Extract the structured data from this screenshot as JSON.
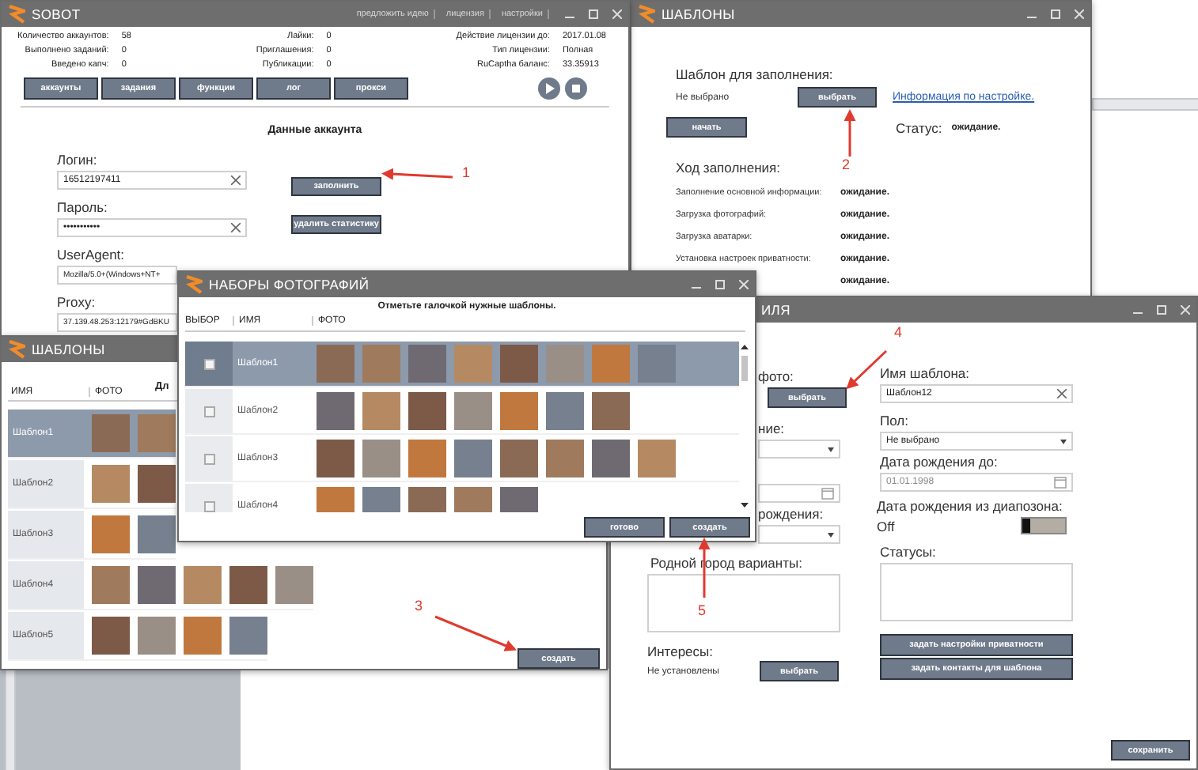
{
  "main_window": {
    "title": "SOBOT",
    "menu": [
      "предложить идею",
      "лицензия",
      "настройки"
    ],
    "stats": [
      [
        {
          "label": "Количество аккаунтов:",
          "value": "58"
        },
        {
          "label": "Выполнено заданий:",
          "value": "0"
        },
        {
          "label": "Введено капч:",
          "value": "0"
        }
      ],
      [
        {
          "label": "Лайки:",
          "value": "0"
        },
        {
          "label": "Приглашения:",
          "value": "0"
        },
        {
          "label": "Публикации:",
          "value": "0"
        }
      ],
      [
        {
          "label": "Действие лицензии до:",
          "value": "2017.01.08"
        },
        {
          "label": "Тип лицензии:",
          "value": "Полная"
        },
        {
          "label": "RuCaptha баланс:",
          "value": "33.35913"
        }
      ]
    ],
    "nav": [
      "аккаунты",
      "задания",
      "функции",
      "лог",
      "прокси"
    ],
    "section_title": "Данные аккаунта",
    "fields": [
      {
        "label": "Логин:",
        "value": "16512197411",
        "clearable": true
      },
      {
        "label": "Пароль:",
        "value": "•••••••••••",
        "clearable": true
      },
      {
        "label": "UserAgent:",
        "value": "Mozilla/5.0+(Windows+NT+",
        "clearable": false
      },
      {
        "label": "Proxy:",
        "value": "37.139.48.253:12179#GdBKU",
        "clearable": false
      }
    ],
    "buttons": [
      "заполнить",
      "удалить статистику"
    ]
  },
  "fill_window": {
    "title": "ШАБЛОНЫ",
    "template_label": "Шаблон для заполнения:",
    "template_value": "Не выбрано",
    "choose_button": "выбрать",
    "help_link": "Информация по настройке.",
    "start_button": "начать",
    "status_label": "Статус:",
    "status_value": "ожидание.",
    "progress_title": "Ход заполнения:",
    "progress": [
      {
        "label": "Заполнение основной информации:",
        "status": "ожидание."
      },
      {
        "label": "Загрузка фотографий:",
        "status": "ожидание."
      },
      {
        "label": "Загрузка аватарки:",
        "status": "ожидание."
      },
      {
        "label": "Установка настроек приватности:",
        "status": "ожидание."
      },
      {
        "status": "ожидание."
      }
    ]
  },
  "templates_window": {
    "title": "ШАБЛОНЫ",
    "heading": "Дл",
    "columns": [
      "ИМЯ",
      "ФОТО"
    ],
    "rows": [
      {
        "name": "Шаблон1",
        "selected": true
      },
      {
        "name": "Шаблон2",
        "selected": false
      },
      {
        "name": "Шаблон3",
        "selected": false
      },
      {
        "name": "Шаблон4",
        "selected": false
      },
      {
        "name": "Шаблон5",
        "selected": false
      }
    ],
    "create_button": "создать"
  },
  "photo_sets_window": {
    "title": "НАБОРЫ ФОТОГРАФИЙ",
    "hint": "Отметьте галочкой нужные шаблоны.",
    "columns": [
      "ВЫБОР",
      "ИМЯ",
      "ФОТО"
    ],
    "rows": [
      {
        "name": "Шаблон1",
        "selected": true,
        "checked": false
      },
      {
        "name": "Шаблон2",
        "selected": false,
        "checked": false
      },
      {
        "name": "Шаблон3",
        "selected": false,
        "checked": false
      },
      {
        "name": "Шаблон4",
        "selected": false,
        "checked": false
      }
    ],
    "buttons": [
      "готово",
      "создать"
    ]
  },
  "profile_window": {
    "title": "ИЛЯ",
    "left": {
      "photo_label": "фото:",
      "photo_button": "выбрать",
      "relation_label": "ние:",
      "birth_label": "рождения:",
      "hometown_label": "Родной город варианты:",
      "interests_label": "Интересы:",
      "interests_value": "Не установлены",
      "interests_button": "выбрать"
    },
    "right": {
      "name_label": "Имя шаблона:",
      "name_value": "Шаблон12",
      "sex_label": "Пол:",
      "sex_value": "Не выбрано",
      "birth_to_label": "Дата рождения до:",
      "birth_to_value": "01.01.1998",
      "range_label": "Дата рождения из диапозона:",
      "range_toggle": {
        "label": "Off",
        "on": false
      },
      "statuses_label": "Статусы:",
      "privacy_button": "задать настройки приватности",
      "contacts_button": "задать контакты для шаблона"
    },
    "save_button": "сохранить"
  },
  "annotations": [
    {
      "label": "1"
    },
    {
      "label": "2"
    },
    {
      "label": "3"
    },
    {
      "label": "4"
    },
    {
      "label": "5"
    }
  ]
}
